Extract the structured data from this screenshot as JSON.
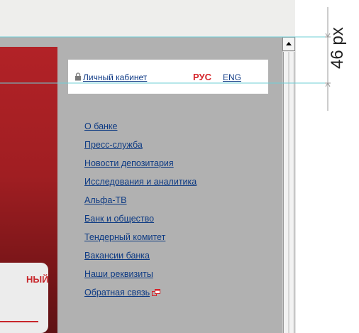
{
  "header": {
    "cabinet_label": "Личный кабинет",
    "lang_rus": "РУС",
    "lang_eng": "ENG"
  },
  "nav": {
    "items": [
      "О банке",
      "Пресс-служба",
      "Новости депозитария",
      "Исследования и аналитика",
      "Альфа-ТВ",
      "Банк и общество",
      "Тендерный комитет",
      "Вакансии банка",
      "Наши реквизиты",
      "Обратная связь"
    ]
  },
  "promo": {
    "label": "НЫЙ"
  },
  "annotation": {
    "dimension": "46 px"
  },
  "colors": {
    "accent_red": "#d5242a",
    "link_blue": "#103b86",
    "panel_grey": "#b1b1b1",
    "guide_cyan": "#6fcfd6"
  },
  "icons": {
    "lock": "lock-icon",
    "external": "external-window-icon",
    "scroll_up": "arrow-up-icon"
  }
}
